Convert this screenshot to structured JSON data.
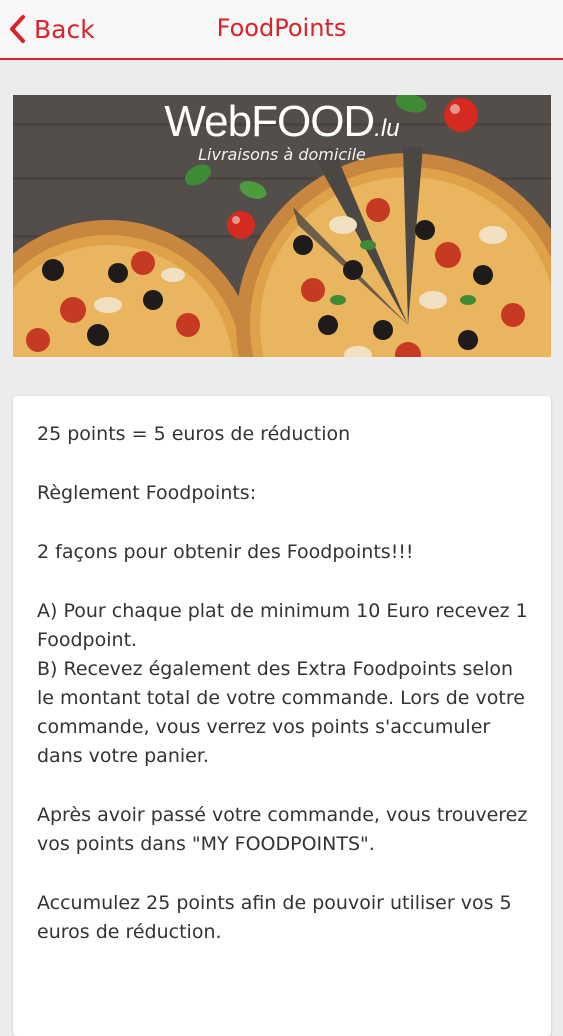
{
  "header": {
    "back_label": "Back",
    "title": "FoodPoints",
    "accent_color": "#d8232a"
  },
  "banner": {
    "brand": "WebFOOD",
    "brand_suffix": ".lu",
    "tagline": "Livraisons à domicile"
  },
  "content": {
    "paragraphs": [
      "25 points = 5 euros de réduction",
      "Règlement Foodpoints:",
      "2 façons pour obtenir des Foodpoints!!!",
      "A) Pour chaque plat de minimum 10 Euro recevez 1 Foodpoint.",
      "B) Recevez également des Extra Foodpoints selon le montant total de votre commande. Lors de votre commande, vous verrez vos points s'accumuler dans votre panier.",
      "Après avoir passé votre commande, vous trouverez vos points dans \"MY FOODPOINTS\".",
      "Accumulez 25 points afin de pouvoir utiliser vos 5 euros de réduction."
    ]
  }
}
